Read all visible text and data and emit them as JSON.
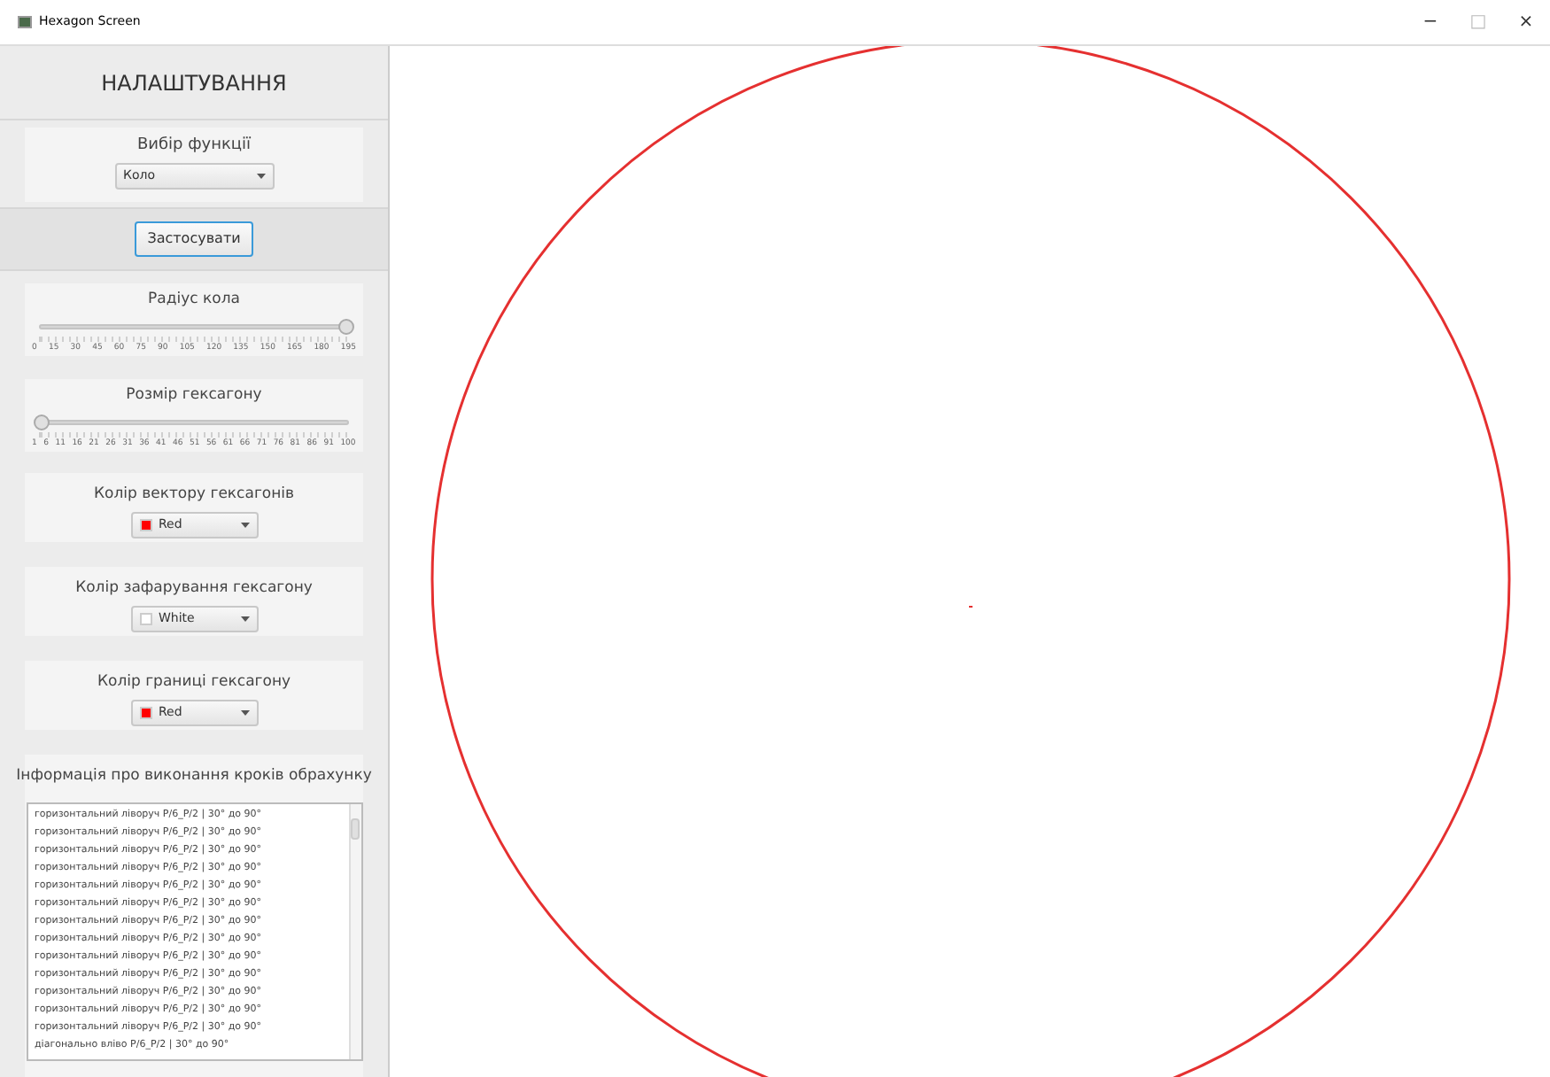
{
  "window": {
    "title": "Hexagon Screen",
    "controls": [
      "−",
      "□",
      "×"
    ]
  },
  "sidebar": {
    "title": "НАЛАШТУВАННЯ",
    "function": {
      "label": "Вибір функції",
      "value": "Коло"
    },
    "apply_button": "Застосувати",
    "sliders": [
      {
        "label": "Радіус кола",
        "level": 1,
        "ticks": [
          "0",
          "15",
          "30",
          "45",
          "60",
          "75",
          "90",
          "105",
          "120",
          "135",
          "150",
          "165",
          "180",
          "195"
        ]
      },
      {
        "label": "Розмір гексагону",
        "level": 0,
        "ticks": [
          "1",
          "6",
          "11",
          "16",
          "21",
          "26",
          "31",
          "36",
          "41",
          "46",
          "51",
          "56",
          "61",
          "66",
          "71",
          "76",
          "81",
          "86",
          "91",
          "100"
        ]
      }
    ],
    "color_pickers": [
      {
        "label": "Колір вектору гексагонів",
        "value": "Red",
        "color": "#ff0000"
      },
      {
        "label": "Колір зафарування гексагону",
        "value": "White",
        "color": "#ffffff"
      },
      {
        "label": "Колір границі гексагону",
        "value": "Red",
        "color": "#ff0000"
      }
    ],
    "log": {
      "title": "Інформація про виконання кроків обрахунку",
      "lines": [
        "горизонтальний ліворуч P/6_P/2 | 30° до 90°",
        "горизонтальний ліворуч P/6_P/2 | 30° до 90°",
        "горизонтальний ліворуч P/6_P/2 | 30° до 90°",
        "горизонтальний ліворуч P/6_P/2 | 30° до 90°",
        "горизонтальний ліворуч P/6_P/2 | 30° до 90°",
        "горизонтальний ліворуч P/6_P/2 | 30° до 90°",
        "горизонтальний ліворуч P/6_P/2 | 30° до 90°",
        "горизонтальний ліворуч P/6_P/2 | 30° до 90°",
        "горизонтальний ліворуч P/6_P/2 | 30° до 90°",
        "горизонтальний ліворуч P/6_P/2 | 30° до 90°",
        "горизонтальний ліворуч P/6_P/2 | 30° до 90°",
        "горизонтальний ліворуч P/6_P/2 | 30° до 90°",
        "горизонтальний ліворуч P/6_P/2 | 30° до 90°",
        "діагонально вліво P/6_P/2 | 30° до 90°"
      ]
    }
  }
}
